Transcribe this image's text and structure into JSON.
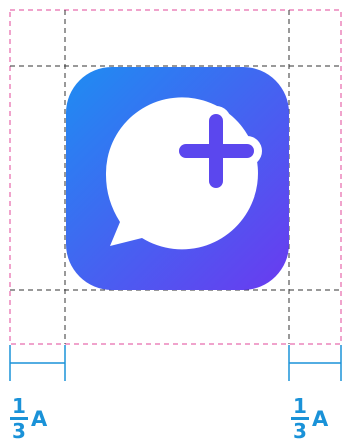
{
  "margin_labels": {
    "left": {
      "numerator": "1",
      "denominator": "3",
      "variable": "A"
    },
    "right": {
      "numerator": "1",
      "denominator": "3",
      "variable": "A"
    }
  },
  "colors": {
    "outer_guide": "#e0479a",
    "inner_guide": "#333333",
    "dimension": "#1a92d8",
    "icon_gradient_start": "#1e8df2",
    "icon_gradient_end": "#6a3af0",
    "bubble": "#ffffff",
    "plus": "#5b47ee"
  },
  "icons": {
    "app_icon": "chat-bubble-plus-icon"
  }
}
